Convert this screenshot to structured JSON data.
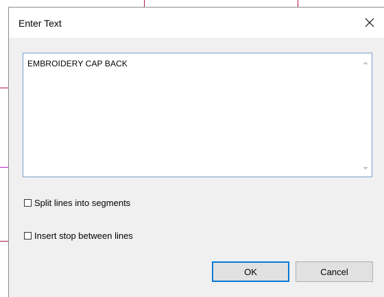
{
  "dialog": {
    "title": "Enter Text",
    "close_glyph": "close-icon"
  },
  "textbox": {
    "value": "EMBROIDERY CAP BACK"
  },
  "options": {
    "split_lines_label": "Split lines into segments",
    "split_lines_checked": false,
    "insert_stop_label": "Insert stop between lines",
    "insert_stop_checked": false
  },
  "buttons": {
    "ok_label": "OK",
    "cancel_label": "Cancel"
  },
  "colors": {
    "guide_line": "#b3154a",
    "guide_line_magenta": "#c21fd1",
    "focus_accent": "#0078d7"
  }
}
